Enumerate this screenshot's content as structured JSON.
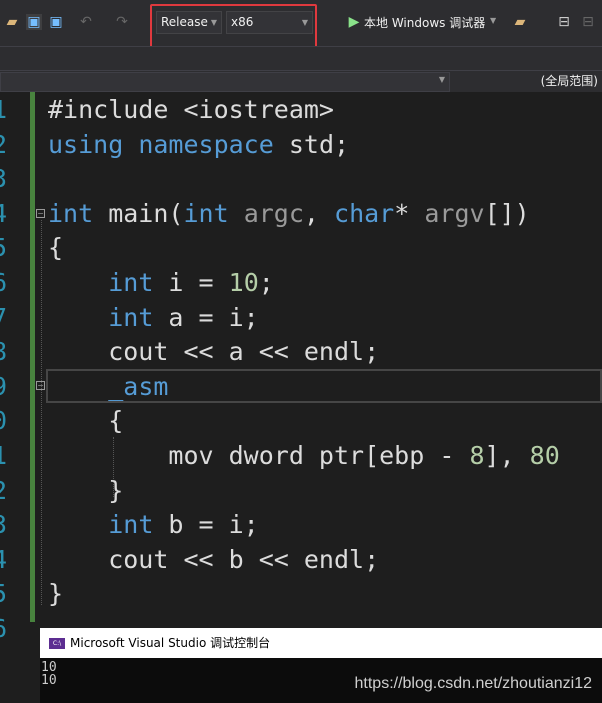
{
  "toolbar": {
    "configuration": "Release",
    "platform": "x86",
    "debugger": "本地 Windows 调试器",
    "highlight_color": "#e0393e"
  },
  "navbar": {
    "scope": "(全局范围)"
  },
  "editor": {
    "line_numbers": [
      "1",
      "2",
      "3",
      "4",
      "5",
      "6",
      "7",
      "8",
      "9",
      "0",
      "1",
      "2",
      "3",
      "4",
      "5",
      "6"
    ],
    "lines": [
      [
        [
          "#include ",
          ""
        ],
        [
          "<iostream>",
          ""
        ]
      ],
      [
        [
          "using",
          "kw"
        ],
        [
          " ",
          ""
        ],
        [
          "namespace",
          "kw"
        ],
        [
          " std;",
          ""
        ]
      ],
      [],
      [
        [
          "int",
          "kw"
        ],
        [
          " main(",
          ""
        ],
        [
          "int",
          "kw"
        ],
        [
          " ",
          ""
        ],
        [
          "argc",
          "prm"
        ],
        [
          ", ",
          ""
        ],
        [
          "char",
          "kw"
        ],
        [
          "* ",
          ""
        ],
        [
          "argv",
          "prm"
        ],
        [
          "[])",
          ""
        ]
      ],
      [
        [
          "{",
          ""
        ]
      ],
      [
        [
          "    ",
          ""
        ],
        [
          "int",
          "kw"
        ],
        [
          " i = ",
          ""
        ],
        [
          "10",
          "num"
        ],
        [
          ";",
          ""
        ]
      ],
      [
        [
          "    ",
          ""
        ],
        [
          "int",
          "kw"
        ],
        [
          " a = i;",
          ""
        ]
      ],
      [
        [
          "    cout << a << endl;",
          ""
        ]
      ],
      [
        [
          "    ",
          ""
        ],
        [
          "_asm",
          "kw"
        ]
      ],
      [
        [
          "    {",
          ""
        ]
      ],
      [
        [
          "        mov dword ptr[ebp - ",
          ""
        ],
        [
          "8",
          "num"
        ],
        [
          "], ",
          ""
        ],
        [
          "80",
          "num"
        ]
      ],
      [
        [
          "    }",
          ""
        ]
      ],
      [
        [
          "    ",
          ""
        ],
        [
          "int",
          "kw"
        ],
        [
          " b = i;",
          ""
        ]
      ],
      [
        [
          "    cout << b << endl;",
          ""
        ]
      ],
      [
        [
          "}",
          ""
        ]
      ],
      []
    ]
  },
  "console": {
    "title": "Microsoft Visual Studio 调试控制台",
    "icon_label": "C:\\",
    "output": [
      "10",
      "10"
    ]
  },
  "watermark": "https://blog.csdn.net/zhoutianzi12"
}
